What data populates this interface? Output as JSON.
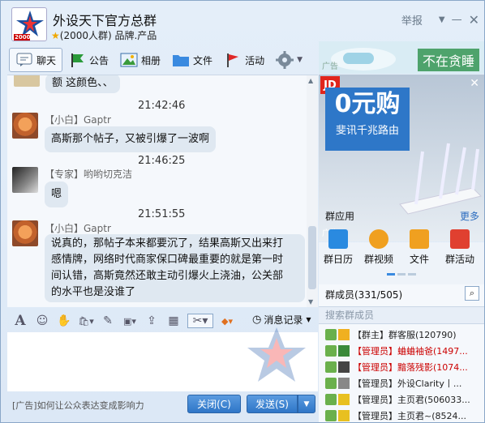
{
  "header": {
    "group_name": "外设天下官方总群",
    "group_info": "(2000人群) 品牌.产品",
    "report_label": "举报",
    "logo_badge": "2000"
  },
  "tabs": [
    {
      "label": "聊天",
      "icon": "chat-icon"
    },
    {
      "label": "公告",
      "icon": "flag-icon"
    },
    {
      "label": "相册",
      "icon": "photo-icon"
    },
    {
      "label": "文件",
      "icon": "folder-icon"
    },
    {
      "label": "活动",
      "icon": "red-flag-icon"
    }
  ],
  "messages": [
    {
      "text": "额 这颜色、、"
    },
    {
      "time": "21:42:46",
      "sender": "【小白】Gaptr",
      "text": "高斯那个帖子，又被引爆了一波啊"
    },
    {
      "time": "21:46:25",
      "sender": "【专家】哟哟切克洁",
      "text": "嗯"
    },
    {
      "time": "21:51:55",
      "sender": "【小白】Gaptr",
      "lines": [
        "说真的，那帖子本来都要沉了，结果高斯又出来打",
        "感情牌，网络时代商家保口碑最重要的就是第一时",
        "间认错，高斯竟然还敢主动引爆火上浇油，公关部",
        "的水平也是没谁了"
      ]
    }
  ],
  "input_toolbar": {
    "history_label": "消息记录"
  },
  "bottom": {
    "ad_text": "[广告]如何让公众表达变成影响力",
    "close_label": "关闭(C)",
    "send_label": "发送(S)"
  },
  "ads": {
    "top_text": "不在贪睡",
    "top_tag": "广告",
    "jd_logo": "JD",
    "jd_big": "0元购",
    "jd_small": "斐讯千兆路由",
    "jd_tag": "广告"
  },
  "apps": {
    "title": "群应用",
    "more": "更多",
    "items": [
      {
        "label": "群日历",
        "color": "#2a8ae0"
      },
      {
        "label": "群视频",
        "color": "#f0a020"
      },
      {
        "label": "文件",
        "color": "#f0a020"
      },
      {
        "label": "群活动",
        "color": "#e04030"
      }
    ]
  },
  "members": {
    "title": "群成员(331/505)",
    "search_placeholder": "搜索群成员",
    "list": [
      {
        "name": "【群主】群客服(120790)",
        "red": false
      },
      {
        "name": "【管理员】蛐蛐袖爸(1497...",
        "red": true
      },
      {
        "name": "【管理员】黯落残影(1074...",
        "red": true
      },
      {
        "name": "【管理员】外设Clarity丨...",
        "red": false
      },
      {
        "name": "【管理员】主页君(506033...",
        "red": false
      },
      {
        "name": "【管理员】主页君~(8524...",
        "red": false
      }
    ]
  }
}
